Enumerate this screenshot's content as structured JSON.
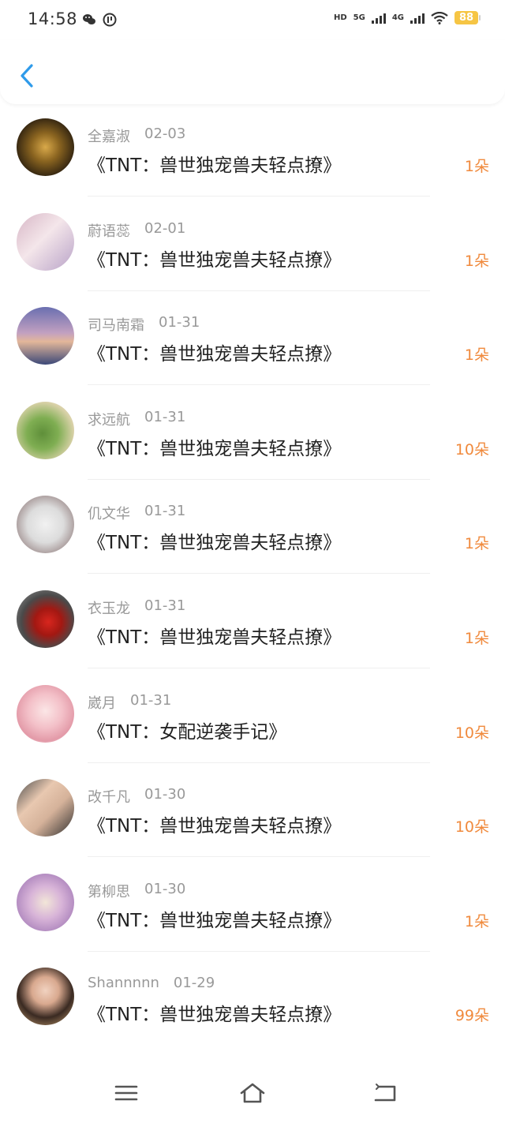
{
  "status_bar": {
    "time": "14:58",
    "hd_label": "HD",
    "net_5g": "5G",
    "net_4g": "4G",
    "battery": "88"
  },
  "list": [
    {
      "name": "全嘉淑",
      "date": "02-03",
      "title": "《TNT：兽世独宠兽夫轻点撩》",
      "amount": "1朵"
    },
    {
      "name": "蔚语蕊",
      "date": "02-01",
      "title": "《TNT：兽世独宠兽夫轻点撩》",
      "amount": "1朵"
    },
    {
      "name": "司马南霜",
      "date": "01-31",
      "title": "《TNT：兽世独宠兽夫轻点撩》",
      "amount": "1朵"
    },
    {
      "name": "求远航",
      "date": "01-31",
      "title": "《TNT：兽世独宠兽夫轻点撩》",
      "amount": "10朵"
    },
    {
      "name": "仉文华",
      "date": "01-31",
      "title": "《TNT：兽世独宠兽夫轻点撩》",
      "amount": "1朵"
    },
    {
      "name": "衣玉龙",
      "date": "01-31",
      "title": "《TNT：兽世独宠兽夫轻点撩》",
      "amount": "1朵"
    },
    {
      "name": "崴月",
      "date": "01-31",
      "title": "《TNT：女配逆袭手记》",
      "amount": "10朵"
    },
    {
      "name": "改千凡",
      "date": "01-30",
      "title": "《TNT：兽世独宠兽夫轻点撩》",
      "amount": "10朵"
    },
    {
      "name": "第柳思",
      "date": "01-30",
      "title": "《TNT：兽世独宠兽夫轻点撩》",
      "amount": "1朵"
    },
    {
      "name": "Shannnnn",
      "date": "01-29",
      "title": "《TNT：兽世独宠兽夫轻点撩》",
      "amount": "99朵"
    }
  ],
  "colors": {
    "accent": "#2f9bea",
    "amount": "#f08a3d",
    "meta": "#999999",
    "title": "#222222"
  },
  "icons": {
    "back": "chevron-left-icon",
    "nav_menu": "menu-icon",
    "nav_home": "home-icon",
    "nav_back": "return-icon"
  }
}
